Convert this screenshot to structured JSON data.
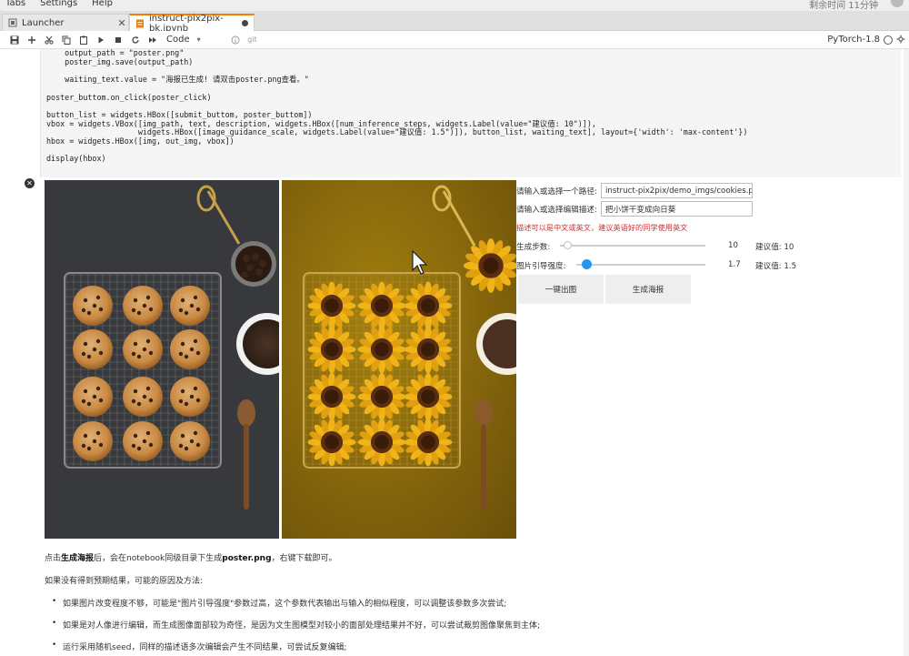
{
  "menu": {
    "items": [
      "Tabs",
      "Settings",
      "Help"
    ],
    "timer": "剩余时间 11分钟"
  },
  "tabs": [
    {
      "label": "Launcher",
      "active": false
    },
    {
      "label": "instruct-pix2pix-bk.ipynb",
      "active": true
    }
  ],
  "toolbar": {
    "cell_type": "Code",
    "icons": [
      "save-icon",
      "add-cell-icon",
      "cut-icon",
      "copy-icon",
      "paste-icon",
      "run-icon",
      "stop-icon",
      "restart-icon",
      "run-all-icon",
      "info-icon",
      "git-icon"
    ],
    "git_label": "git",
    "kernel": "PyTorch-1.8"
  },
  "code": {
    "lines": [
      "    output_path = \"poster.png\"",
      "    poster_img.save(output_path)",
      "",
      "    waiting_text.value = \"海报已生成! 请双击poster.png查看。\"",
      "",
      "poster_buttom.on_click(poster_click)",
      "",
      "button_list = widgets.HBox([submit_buttom, poster_buttom])",
      "vbox = widgets.VBox([img_path, text, description, widgets.HBox([num_inference_steps, widgets.Label(value=\"建议值: 10\")]),",
      "                    widgets.HBox([image_guidance_scale, widgets.Label(value=\"建议值: 1.5\")]), button_list, waiting_text], layout={'width': 'max-content'})",
      "hbox = widgets.HBox([img, out_img, vbox])",
      "",
      "display(hbox)"
    ]
  },
  "widgets": {
    "path_label": "请输入或选择一个路径:",
    "path_value": "instruct-pix2pix/demo_imgs/cookies.pn",
    "edit_label": "请输入或选择编辑描述:",
    "edit_value": "把小饼干变成向日葵",
    "warning": "描述可以是中文或英文，建议英语好的同学使用英文",
    "steps_label": "生成步数:",
    "steps_value": "10",
    "steps_hint": "建议值: 10",
    "steps_fraction": 0.05,
    "guidance_label": "图片引导强度:",
    "guidance_value": "1.7",
    "guidance_hint": "建议值: 1.5",
    "guidance_fraction": 0.08,
    "button_generate": "一键出图",
    "button_poster": "生成海报",
    "accent": "#2196f3",
    "warning_color": "#d32f2f"
  },
  "markdown": {
    "p1_prefix": "点击",
    "p1_bold1": "生成海报",
    "p1_mid": "后，会在notebook同级目录下生成",
    "p1_bold2": "poster.png",
    "p1_suffix": "，右键下载即可。",
    "p2": "如果没有得到预期结果，可能的原因及方法:",
    "bullets": [
      "如果图片改变程度不够，可能是\"图片引导强度\"参数过高，这个参数代表输出与输入的相似程度，可以调整该参数多次尝试;",
      "如果是对人像进行编辑，而生成图像面部较为奇怪，是因为文生图模型对较小的面部处理结果并不好，可以尝试裁剪图像聚焦到主体;",
      "运行采用随机seed，同样的描述语多次编辑会产生不同结果，可尝试反复编辑;"
    ]
  }
}
